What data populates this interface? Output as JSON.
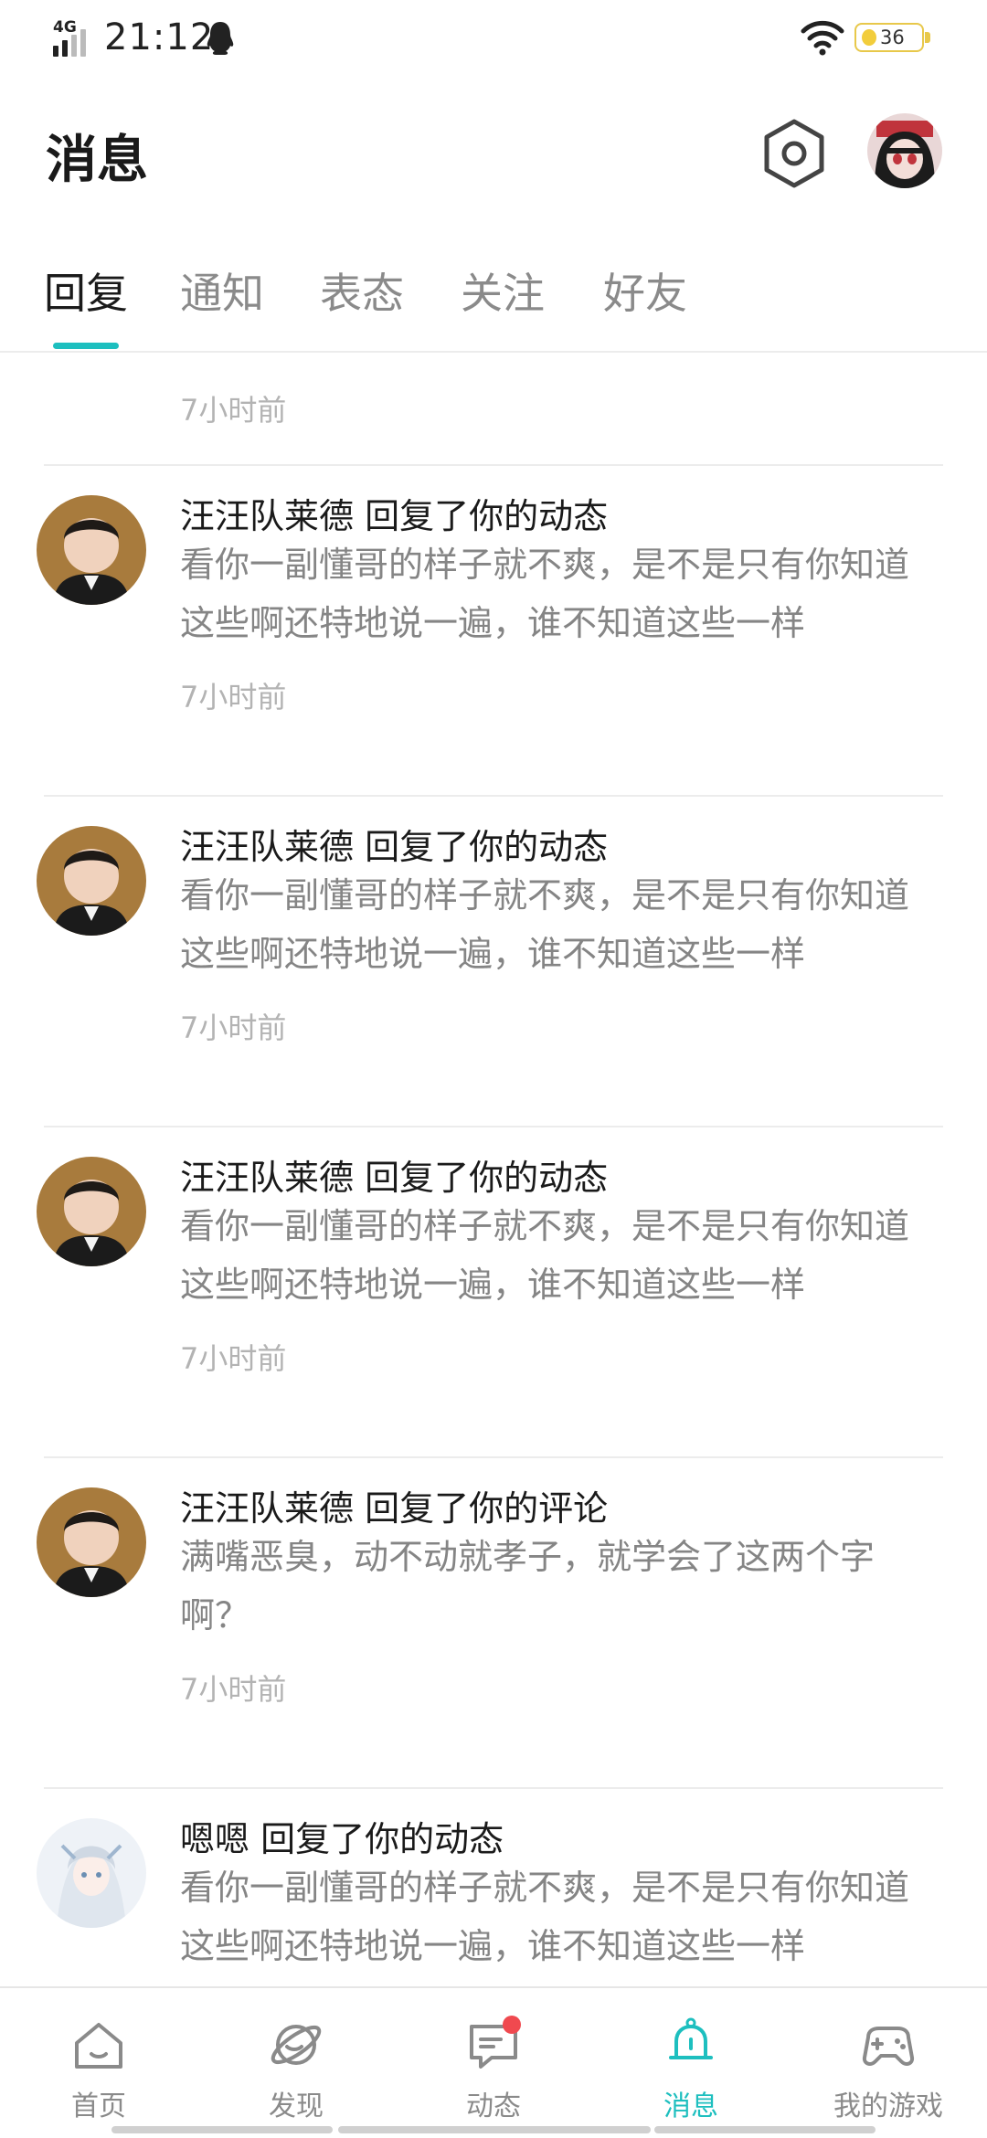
{
  "status_bar": {
    "network": "4G",
    "time": "21:12",
    "battery_level": "36",
    "icons": [
      "signal-icon",
      "qq-icon",
      "wifi-icon",
      "battery-icon"
    ]
  },
  "header": {
    "title": "消息",
    "icons": [
      "settings-hexagon-icon",
      "profile-avatar"
    ]
  },
  "tabs": [
    {
      "label": "回复",
      "active": true
    },
    {
      "label": "通知",
      "active": false
    },
    {
      "label": "表态",
      "active": false
    },
    {
      "label": "关注",
      "active": false
    },
    {
      "label": "好友",
      "active": false
    }
  ],
  "list": {
    "partial_top_time": "7小时前",
    "items": [
      {
        "title": "汪汪队莱德 回复了你的动态",
        "body": "看你一副懂哥的样子就不爽，是不是只有你知道这些啊还特地说一遍，谁不知道这些一样",
        "time": "7小时前"
      },
      {
        "title": "汪汪队莱德 回复了你的动态",
        "body": "看你一副懂哥的样子就不爽，是不是只有你知道这些啊还特地说一遍，谁不知道这些一样",
        "time": "7小时前"
      },
      {
        "title": "汪汪队莱德 回复了你的动态",
        "body": "看你一副懂哥的样子就不爽，是不是只有你知道这些啊还特地说一遍，谁不知道这些一样",
        "time": "7小时前"
      },
      {
        "title": "汪汪队莱德 回复了你的评论",
        "body": "满嘴恶臭，动不动就孝子，就学会了这两个字啊？",
        "time": "7小时前"
      },
      {
        "title": "嗯嗯 回复了你的动态",
        "body": "看你一副懂哥的样子就不爽，是不是只有你知道这些啊还特地说一遍，谁不知道这些一样",
        "time": ""
      }
    ]
  },
  "bottom_nav": [
    {
      "label": "首页",
      "icon": "home-icon",
      "active": false
    },
    {
      "label": "发现",
      "icon": "planet-icon",
      "active": false
    },
    {
      "label": "动态",
      "icon": "chat-bubble-icon",
      "active": false,
      "badge": true
    },
    {
      "label": "消息",
      "icon": "bell-icon",
      "active": true
    },
    {
      "label": "我的游戏",
      "icon": "gamepad-icon",
      "active": false
    }
  ],
  "colors": {
    "accent": "#1dbfbf",
    "badge": "#f0494f",
    "title_text": "#1a1a1a",
    "body_text": "#858585",
    "time_text": "#b3b3b3",
    "battery": "#e8c84a"
  }
}
